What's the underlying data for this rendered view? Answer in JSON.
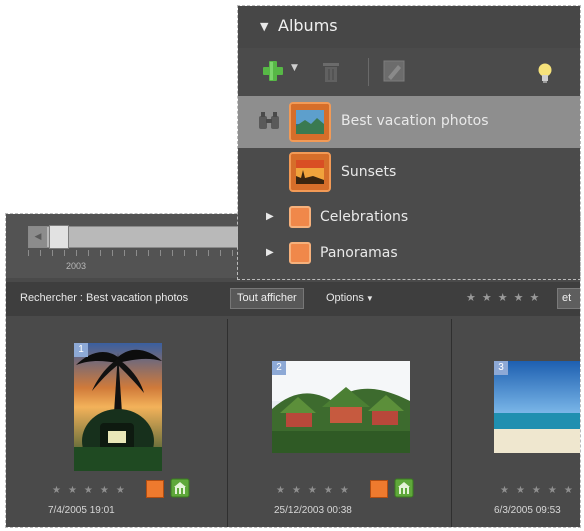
{
  "albums_panel": {
    "title": "Albums",
    "albums": [
      {
        "name": "Best vacation photos",
        "selected": true
      },
      {
        "name": "Sunsets",
        "selected": false
      },
      {
        "name": "Celebrations",
        "selected": false
      },
      {
        "name": "Panoramas",
        "selected": false
      }
    ],
    "icons": {
      "collapse": "triangle-down-icon",
      "add": "plus-icon",
      "add_menu": "chevron-down-icon",
      "delete": "trash-icon",
      "edit": "pencil-icon",
      "tip": "lightbulb-icon",
      "find": "binoculars-icon"
    }
  },
  "timeline": {
    "year_label": "2003"
  },
  "search_bar": {
    "label": "Rechercher : Best vacation photos",
    "show_all_label": "Tout afficher",
    "options_label": "Options",
    "filter_value": "et"
  },
  "photos": [
    {
      "number": "1",
      "date": "7/4/2005 19:01",
      "rating": 0
    },
    {
      "number": "2",
      "date": "25/12/2003 00:38",
      "rating": 0
    },
    {
      "number": "3",
      "date": "6/3/2005 09:53",
      "rating": 0
    }
  ],
  "colors": {
    "panel_bg": "#4b4b4b",
    "selected_row": "#8e8e8e",
    "album_orange": "#e8732c",
    "photo_number_bg": "#8da9d6"
  }
}
